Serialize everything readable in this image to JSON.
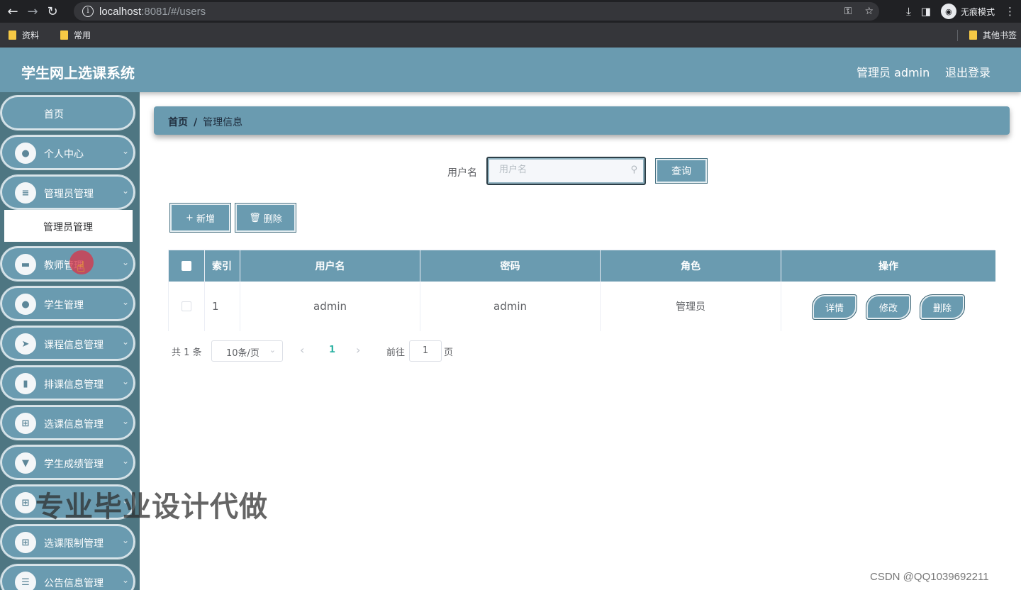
{
  "browser": {
    "url_host": "localhost",
    "url_rest": ":8081/#/users",
    "incognito_label": "无痕模式",
    "bookmarks": [
      "资料",
      "常用"
    ],
    "other_bookmarks": "其他书签"
  },
  "header": {
    "title": "学生网上选课系统",
    "user": "管理员 admin",
    "logout": "退出登录"
  },
  "sidebar": {
    "home": "首页",
    "items": [
      {
        "label": "个人中心",
        "icon": "user-icon"
      },
      {
        "label": "管理员管理",
        "icon": "list-icon"
      },
      {
        "label": "教师管理",
        "icon": "briefcase-icon"
      },
      {
        "label": "学生管理",
        "icon": "user-icon"
      },
      {
        "label": "课程信息管理",
        "icon": "send-icon"
      },
      {
        "label": "排课信息管理",
        "icon": "bar-chart-icon"
      },
      {
        "label": "选课信息管理",
        "icon": "grid-icon"
      },
      {
        "label": "学生成绩管理",
        "icon": "pin-icon"
      },
      {
        "label": "",
        "icon": "grid-icon"
      },
      {
        "label": "选课限制管理",
        "icon": "grid-icon"
      },
      {
        "label": "公告信息管理",
        "icon": "sliders-icon"
      }
    ],
    "submenu_active": "管理员管理"
  },
  "breadcrumb": {
    "home": "首页",
    "separator": "/",
    "current": "管理信息"
  },
  "search": {
    "label": "用户名",
    "placeholder": "用户名",
    "value": "",
    "button": "查询"
  },
  "actions": {
    "add": "新增",
    "delete": "删除"
  },
  "table": {
    "columns": [
      "索引",
      "用户名",
      "密码",
      "角色",
      "操作"
    ],
    "rows": [
      {
        "index": "1",
        "username": "admin",
        "password": "admin",
        "role": "管理员"
      }
    ],
    "row_actions": [
      "详情",
      "修改",
      "删除"
    ]
  },
  "pagination": {
    "total": "共 1 条",
    "page_size": "10条/页",
    "current_page": "1",
    "goto_label": "前往",
    "goto_value": "1",
    "page_suffix": "页"
  },
  "overlay": {
    "watermark": "专业毕业设计代做",
    "credit": "CSDN @QQ1039692211"
  },
  "colors": {
    "accent": "#6a9bb0",
    "sidebar_bg": "#4e7682",
    "active_page": "#2fb3a4"
  }
}
